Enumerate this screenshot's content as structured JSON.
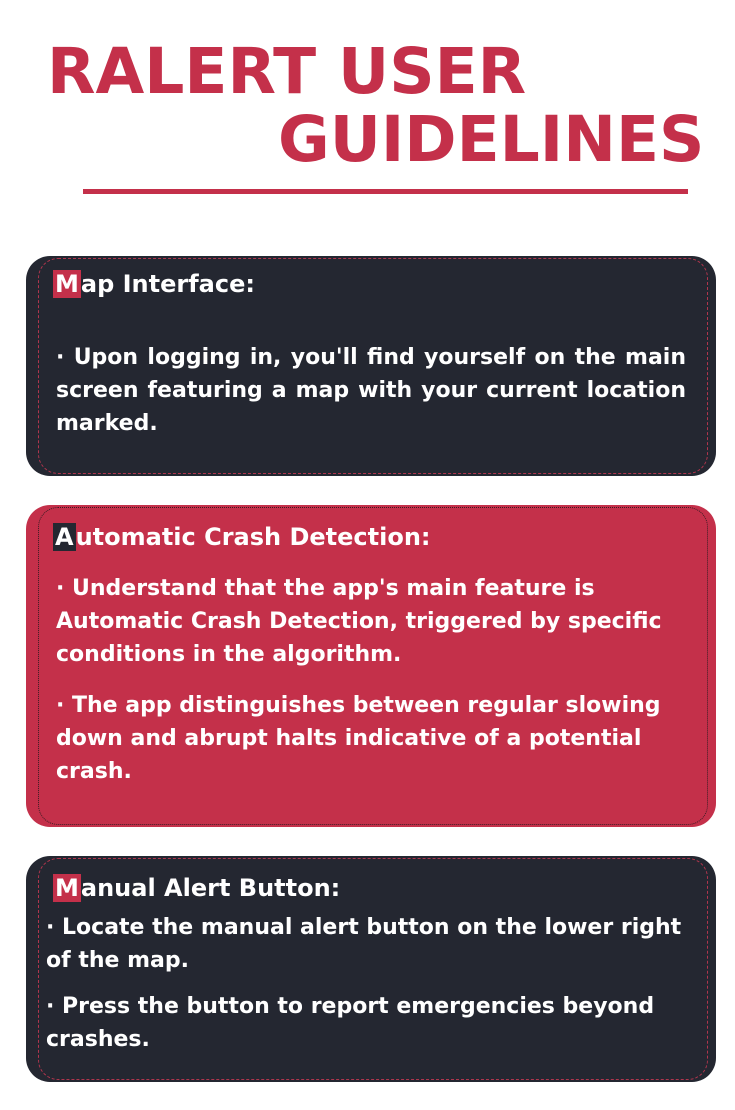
{
  "header": {
    "title_line1": "RALERT USER",
    "title_line2": "GUIDELINES"
  },
  "sections": [
    {
      "first_letter": "M",
      "heading_rest": "ap Interface:",
      "paragraphs": [
        "· Upon logging in, you'll find yourself on the main screen featuring a map with your current location marked."
      ]
    },
    {
      "first_letter": "A",
      "heading_rest": "utomatic Crash Detection:",
      "paragraphs": [
        "· Understand that the app's main feature is Automatic Crash Detection, triggered by specific conditions in the algorithm.",
        "· The app distinguishes between regular slowing down and abrupt halts indicative of a potential crash."
      ]
    },
    {
      "first_letter": "M",
      "heading_rest": "anual Alert Button:",
      "paragraphs": [
        "· Locate the manual alert button on the lower right of the map.",
        "· Press the button to report emergencies beyond crashes."
      ]
    }
  ],
  "colors": {
    "accent": "#c4304a",
    "dark_panel": "#242731",
    "text_on_panel": "#ffffff",
    "background": "#ffffff"
  }
}
